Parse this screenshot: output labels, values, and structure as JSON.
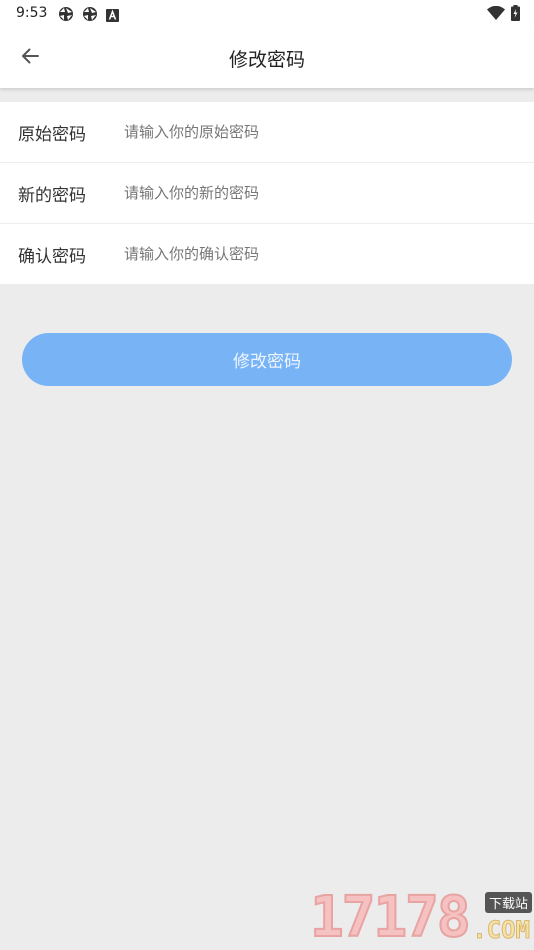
{
  "status_bar": {
    "time": "9:53"
  },
  "app_bar": {
    "title": "修改密码"
  },
  "form": {
    "rows": [
      {
        "label": "原始密码",
        "placeholder": "请输入你的原始密码",
        "value": ""
      },
      {
        "label": "新的密码",
        "placeholder": "请输入你的新的密码",
        "value": ""
      },
      {
        "label": "确认密码",
        "placeholder": "请输入你的确认密码",
        "value": ""
      }
    ]
  },
  "submit": {
    "label": "修改密码"
  },
  "watermark": {
    "digits": "17178",
    "tag": "下载站",
    "com": ".COM"
  },
  "colors": {
    "accent": "#78b4f5",
    "background": "#ececec",
    "surface": "#ffffff"
  },
  "icons": {
    "back": "arrow-left-icon",
    "status_left": [
      "aperture-icon",
      "aperture-icon",
      "letter-a-icon"
    ],
    "status_right": [
      "wifi-icon",
      "battery-icon"
    ]
  }
}
